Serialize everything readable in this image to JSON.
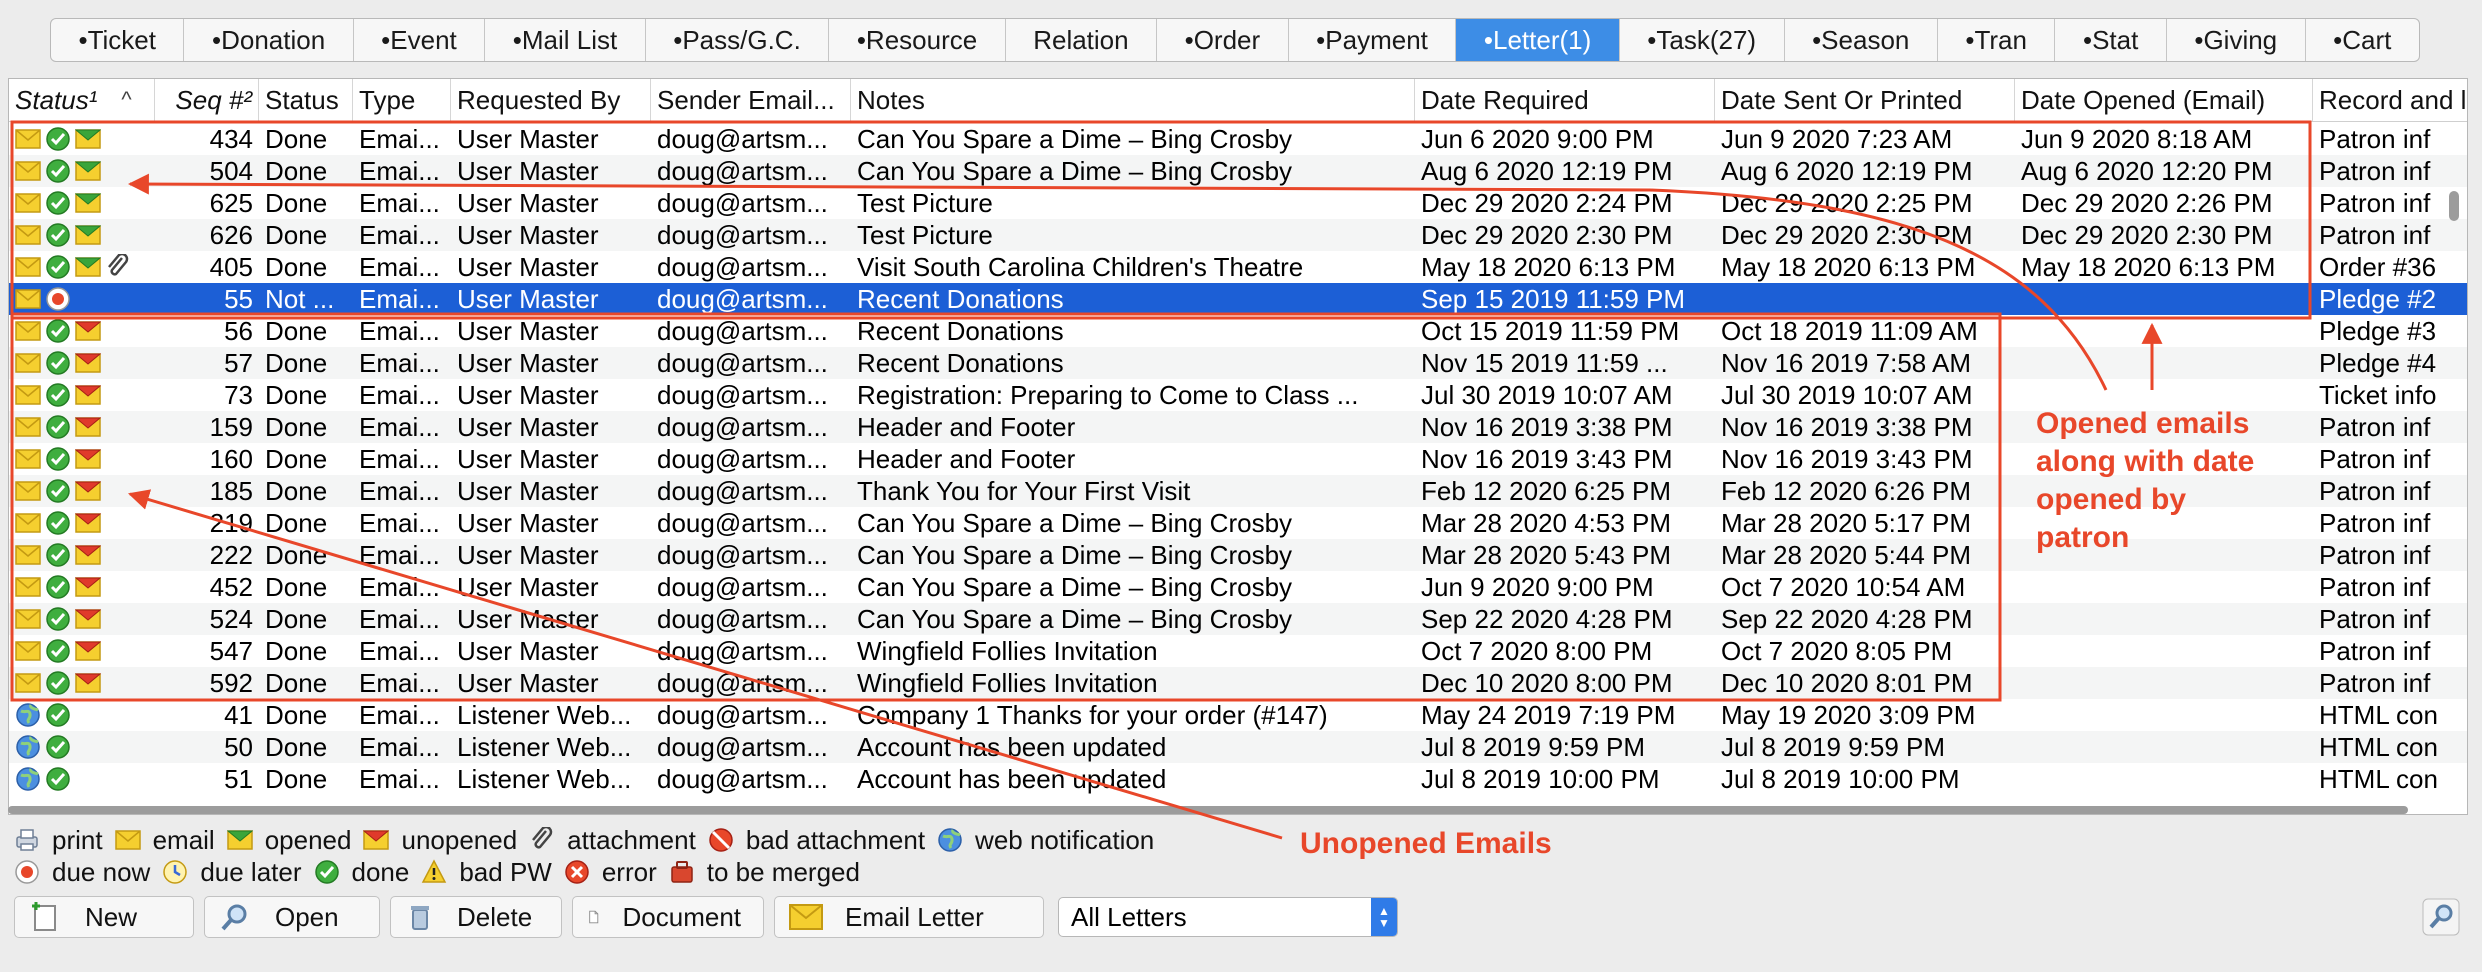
{
  "tabs": [
    {
      "label": "•Ticket",
      "active": false
    },
    {
      "label": "•Donation",
      "active": false
    },
    {
      "label": "•Event",
      "active": false
    },
    {
      "label": "•Mail List",
      "active": false
    },
    {
      "label": "•Pass/G.C.",
      "active": false
    },
    {
      "label": "•Resource",
      "active": false
    },
    {
      "label": "Relation",
      "active": false
    },
    {
      "label": "•Order",
      "active": false
    },
    {
      "label": "•Payment",
      "active": false
    },
    {
      "label": "•Letter(1)",
      "active": true
    },
    {
      "label": "•Task(27)",
      "active": false
    },
    {
      "label": "•Season",
      "active": false
    },
    {
      "label": "•Tran",
      "active": false
    },
    {
      "label": "•Stat",
      "active": false
    },
    {
      "label": "•Giving",
      "active": false
    },
    {
      "label": "•Cart",
      "active": false
    }
  ],
  "table": {
    "columns": [
      "Status¹",
      "Seq #²",
      "Status",
      "Type",
      "Requested By",
      "Sender Email...",
      "Notes",
      "Date Required",
      "Date Sent Or Printed",
      "Date Opened (Email)",
      "Record and l"
    ],
    "rows": [
      {
        "icons": [
          "email",
          "done",
          "opened"
        ],
        "seq": "434",
        "status": "Done",
        "type": "Emai...",
        "by": "User Master",
        "sender": "doug@artsm...",
        "notes": "Can You Spare a Dime – Bing Crosby",
        "required": "Jun 6 2020 9:00 PM",
        "sent": "Jun 9 2020 7:23 AM",
        "opened": "Jun 9 2020 8:18 AM",
        "record": "Patron inf"
      },
      {
        "icons": [
          "email",
          "done",
          "opened"
        ],
        "seq": "504",
        "status": "Done",
        "type": "Emai...",
        "by": "User Master",
        "sender": "doug@artsm...",
        "notes": "Can You Spare a Dime – Bing Crosby",
        "required": "Aug 6 2020 12:19 PM",
        "sent": "Aug 6 2020 12:19 PM",
        "opened": "Aug 6 2020 12:20 PM",
        "record": "Patron inf"
      },
      {
        "icons": [
          "email",
          "done",
          "opened"
        ],
        "seq": "625",
        "status": "Done",
        "type": "Emai...",
        "by": "User Master",
        "sender": "doug@artsm...",
        "notes": "Test Picture",
        "required": "Dec 29 2020 2:24 PM",
        "sent": "Dec 29 2020 2:25 PM",
        "opened": "Dec 29 2020 2:26 PM",
        "record": "Patron inf"
      },
      {
        "icons": [
          "email",
          "done",
          "opened"
        ],
        "seq": "626",
        "status": "Done",
        "type": "Emai...",
        "by": "User Master",
        "sender": "doug@artsm...",
        "notes": "Test Picture",
        "required": "Dec 29 2020 2:30 PM",
        "sent": "Dec 29 2020 2:30 PM",
        "opened": "Dec 29 2020 2:30 PM",
        "record": "Patron inf"
      },
      {
        "icons": [
          "email",
          "done",
          "opened",
          "attachment"
        ],
        "seq": "405",
        "status": "Done",
        "type": "Emai...",
        "by": "User Master",
        "sender": "doug@artsm...",
        "notes": "Visit South Carolina Children's Theatre",
        "required": "May 18 2020 6:13 PM",
        "sent": "May 18 2020 6:13 PM",
        "opened": "May 18 2020 6:13 PM",
        "record": "Order #36"
      },
      {
        "icons": [
          "email",
          "due-now"
        ],
        "seq": "55",
        "status": "Not ...",
        "type": "Emai...",
        "by": "User Master",
        "sender": "doug@artsm...",
        "notes": "Recent Donations",
        "required": "Sep 15 2019 11:59 PM",
        "sent": "",
        "opened": "",
        "record": "Pledge #2"
      },
      {
        "icons": [
          "email",
          "done",
          "unopened"
        ],
        "seq": "56",
        "status": "Done",
        "type": "Emai...",
        "by": "User Master",
        "sender": "doug@artsm...",
        "notes": "Recent Donations",
        "required": "Oct 15 2019 11:59 PM",
        "sent": "Oct 18 2019 11:09 AM",
        "opened": "",
        "record": "Pledge #3"
      },
      {
        "icons": [
          "email",
          "done",
          "unopened"
        ],
        "seq": "57",
        "status": "Done",
        "type": "Emai...",
        "by": "User Master",
        "sender": "doug@artsm...",
        "notes": "Recent Donations",
        "required": "Nov 15 2019 11:59 ...",
        "sent": "Nov 16 2019 7:58 AM",
        "opened": "",
        "record": "Pledge #4"
      },
      {
        "icons": [
          "email",
          "done",
          "unopened"
        ],
        "seq": "73",
        "status": "Done",
        "type": "Emai...",
        "by": "User Master",
        "sender": "doug@artsm...",
        "notes": "Registration: Preparing to Come to Class ...",
        "required": "Jul 30 2019 10:07 AM",
        "sent": "Jul 30 2019 10:07 AM",
        "opened": "",
        "record": "Ticket info"
      },
      {
        "icons": [
          "email",
          "done",
          "unopened"
        ],
        "seq": "159",
        "status": "Done",
        "type": "Emai...",
        "by": "User Master",
        "sender": "doug@artsm...",
        "notes": "Header and Footer",
        "required": "Nov 16 2019 3:38 PM",
        "sent": "Nov 16 2019 3:38 PM",
        "opened": "",
        "record": "Patron inf"
      },
      {
        "icons": [
          "email",
          "done",
          "unopened"
        ],
        "seq": "160",
        "status": "Done",
        "type": "Emai...",
        "by": "User Master",
        "sender": "doug@artsm...",
        "notes": "Header and Footer",
        "required": "Nov 16 2019 3:43 PM",
        "sent": "Nov 16 2019 3:43 PM",
        "opened": "",
        "record": "Patron inf"
      },
      {
        "icons": [
          "email",
          "done",
          "unopened"
        ],
        "seq": "185",
        "status": "Done",
        "type": "Emai...",
        "by": "User Master",
        "sender": "doug@artsm...",
        "notes": "Thank You for Your First Visit",
        "required": "Feb 12 2020 6:25 PM",
        "sent": "Feb 12 2020 6:26 PM",
        "opened": "",
        "record": "Patron inf"
      },
      {
        "icons": [
          "email",
          "done",
          "unopened"
        ],
        "seq": "219",
        "status": "Done",
        "type": "Emai...",
        "by": "User Master",
        "sender": "doug@artsm...",
        "notes": "Can You Spare a Dime – Bing Crosby",
        "required": "Mar 28 2020 4:53 PM",
        "sent": "Mar 28 2020 5:17 PM",
        "opened": "",
        "record": "Patron inf"
      },
      {
        "icons": [
          "email",
          "done",
          "unopened"
        ],
        "seq": "222",
        "status": "Done",
        "type": "Emai...",
        "by": "User Master",
        "sender": "doug@artsm...",
        "notes": "Can You Spare a Dime – Bing Crosby",
        "required": "Mar 28 2020 5:43 PM",
        "sent": "Mar 28 2020 5:44 PM",
        "opened": "",
        "record": "Patron inf"
      },
      {
        "icons": [
          "email",
          "done",
          "unopened"
        ],
        "seq": "452",
        "status": "Done",
        "type": "Emai...",
        "by": "User Master",
        "sender": "doug@artsm...",
        "notes": "Can You Spare a Dime – Bing Crosby",
        "required": "Jun 9 2020 9:00 PM",
        "sent": "Oct 7 2020 10:54 AM",
        "opened": "",
        "record": "Patron inf"
      },
      {
        "icons": [
          "email",
          "done",
          "unopened"
        ],
        "seq": "524",
        "status": "Done",
        "type": "Emai...",
        "by": "User Master",
        "sender": "doug@artsm...",
        "notes": "Can You Spare a Dime – Bing Crosby",
        "required": "Sep 22 2020 4:28 PM",
        "sent": "Sep 22 2020 4:28 PM",
        "opened": "",
        "record": "Patron inf"
      },
      {
        "icons": [
          "email",
          "done",
          "unopened"
        ],
        "seq": "547",
        "status": "Done",
        "type": "Emai...",
        "by": "User Master",
        "sender": "doug@artsm...",
        "notes": "Wingfield Follies Invitation",
        "required": "Oct 7 2020 8:00 PM",
        "sent": "Oct 7 2020 8:05 PM",
        "opened": "",
        "record": "Patron inf"
      },
      {
        "icons": [
          "email",
          "done",
          "unopened"
        ],
        "seq": "592",
        "status": "Done",
        "type": "Emai...",
        "by": "User Master",
        "sender": "doug@artsm...",
        "notes": "Wingfield Follies Invitation",
        "required": "Dec 10 2020 8:00 PM",
        "sent": "Dec 10 2020 8:01 PM",
        "opened": "",
        "record": "Patron inf"
      },
      {
        "icons": [
          "web",
          "done"
        ],
        "seq": "41",
        "status": "Done",
        "type": "Emai...",
        "by": "Listener Web...",
        "sender": "doug@artsm...",
        "notes": "Company 1 Thanks for your order (#147)",
        "required": "May 24 2019 7:19 PM",
        "sent": "May 19 2020 3:09 PM",
        "opened": "",
        "record": "HTML con"
      },
      {
        "icons": [
          "web",
          "done"
        ],
        "seq": "50",
        "status": "Done",
        "type": "Emai...",
        "by": "Listener Web...",
        "sender": "doug@artsm...",
        "notes": "Account has been updated",
        "required": "Jul 8 2019 9:59 PM",
        "sent": "Jul 8 2019 9:59 PM",
        "opened": "",
        "record": "HTML con"
      },
      {
        "icons": [
          "web",
          "done"
        ],
        "seq": "51",
        "status": "Done",
        "type": "Emai...",
        "by": "Listener Web...",
        "sender": "doug@artsm...",
        "notes": "Account has been updated",
        "required": "Jul 8 2019 10:00 PM",
        "sent": "Jul 8 2019 10:00 PM",
        "opened": "",
        "record": "HTML con"
      }
    ]
  },
  "legend": {
    "line1": [
      {
        "icon": "print",
        "label": "print"
      },
      {
        "icon": "email",
        "label": "email"
      },
      {
        "icon": "opened",
        "label": "opened"
      },
      {
        "icon": "unopened",
        "label": "unopened"
      },
      {
        "icon": "attachment",
        "label": "attachment"
      },
      {
        "icon": "bad-attachment",
        "label": "bad attachment"
      },
      {
        "icon": "web",
        "label": "web notification"
      }
    ],
    "line2": [
      {
        "icon": "due-now",
        "label": "due now"
      },
      {
        "icon": "due-later",
        "label": "due later"
      },
      {
        "icon": "done",
        "label": "done"
      },
      {
        "icon": "bad-pw",
        "label": "bad PW"
      },
      {
        "icon": "error",
        "label": "error"
      },
      {
        "icon": "to-be-merged",
        "label": "to be merged"
      }
    ]
  },
  "toolbar": {
    "new_label": "New",
    "open_label": "Open",
    "delete_label": "Delete",
    "document_label": "Document",
    "email_label": "Email Letter",
    "filter_value": "All Letters"
  },
  "annotations": {
    "opened_text": [
      "Opened emails",
      "along with date",
      "opened by",
      "patron"
    ],
    "unopened_text": "Unopened Emails",
    "color": "#e8472a"
  },
  "colors": {
    "selected_row": "#1c5fd6",
    "active_tab": "#3d8de6",
    "annotation": "#e8472a"
  }
}
